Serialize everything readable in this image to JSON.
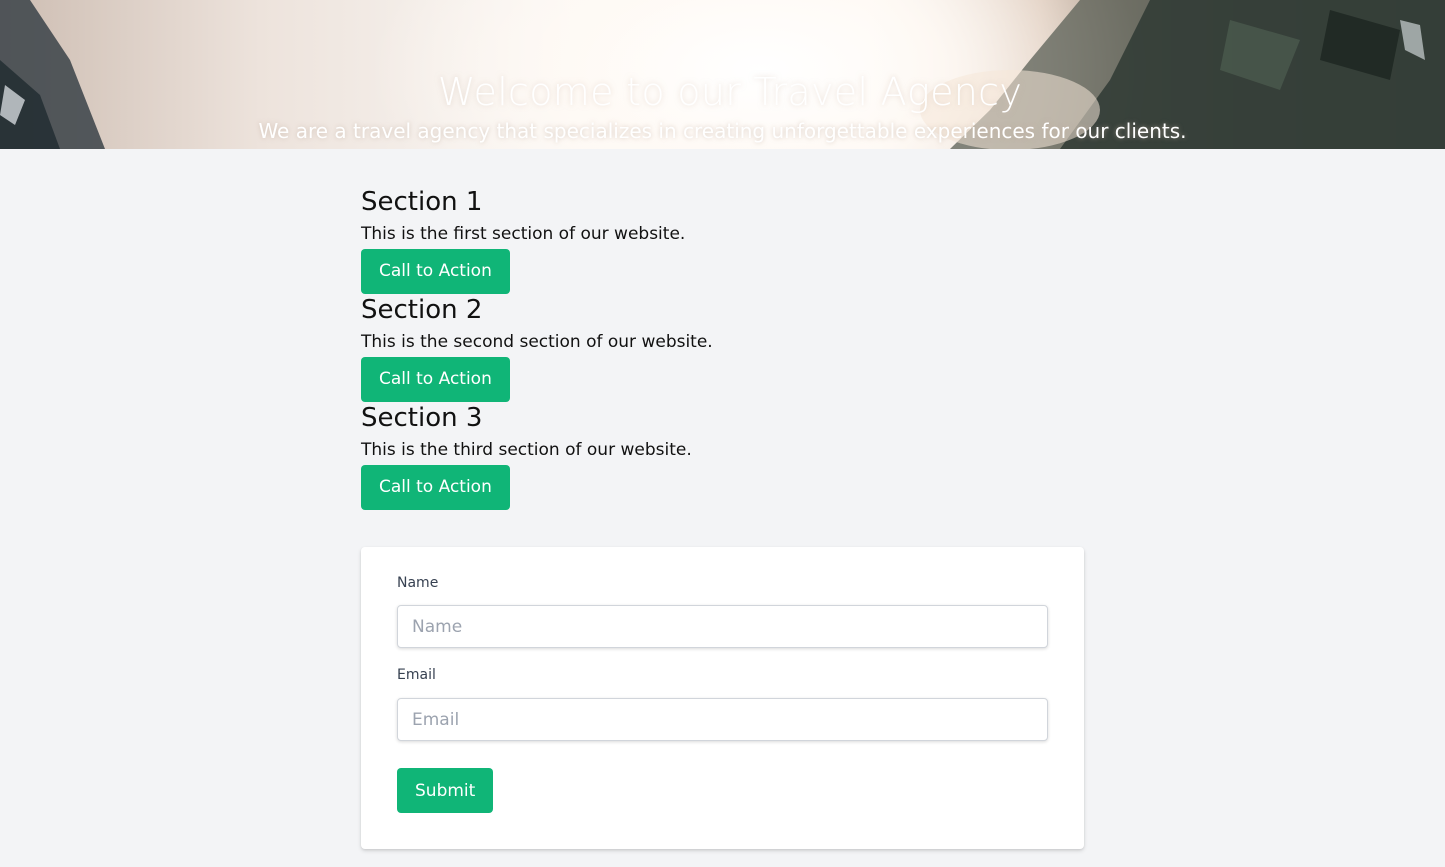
{
  "hero": {
    "title": "Welcome to our Travel Agency",
    "subtitle": "We are a travel agency that specializes in creating unforgettable experiences for our clients."
  },
  "sections": [
    {
      "heading": "Section 1",
      "text": "This is the first section of our website.",
      "button": "Call to Action"
    },
    {
      "heading": "Section 2",
      "text": "This is the second section of our website.",
      "button": "Call to Action"
    },
    {
      "heading": "Section 3",
      "text": "This is the third section of our website.",
      "button": "Call to Action"
    }
  ],
  "form": {
    "name_label": "Name",
    "name_placeholder": "Name",
    "name_value": "",
    "email_label": "Email",
    "email_placeholder": "Email",
    "email_value": "",
    "submit_label": "Submit"
  },
  "colors": {
    "accent": "#10b577",
    "page_background": "#f3f4f6",
    "card_background": "#ffffff"
  }
}
